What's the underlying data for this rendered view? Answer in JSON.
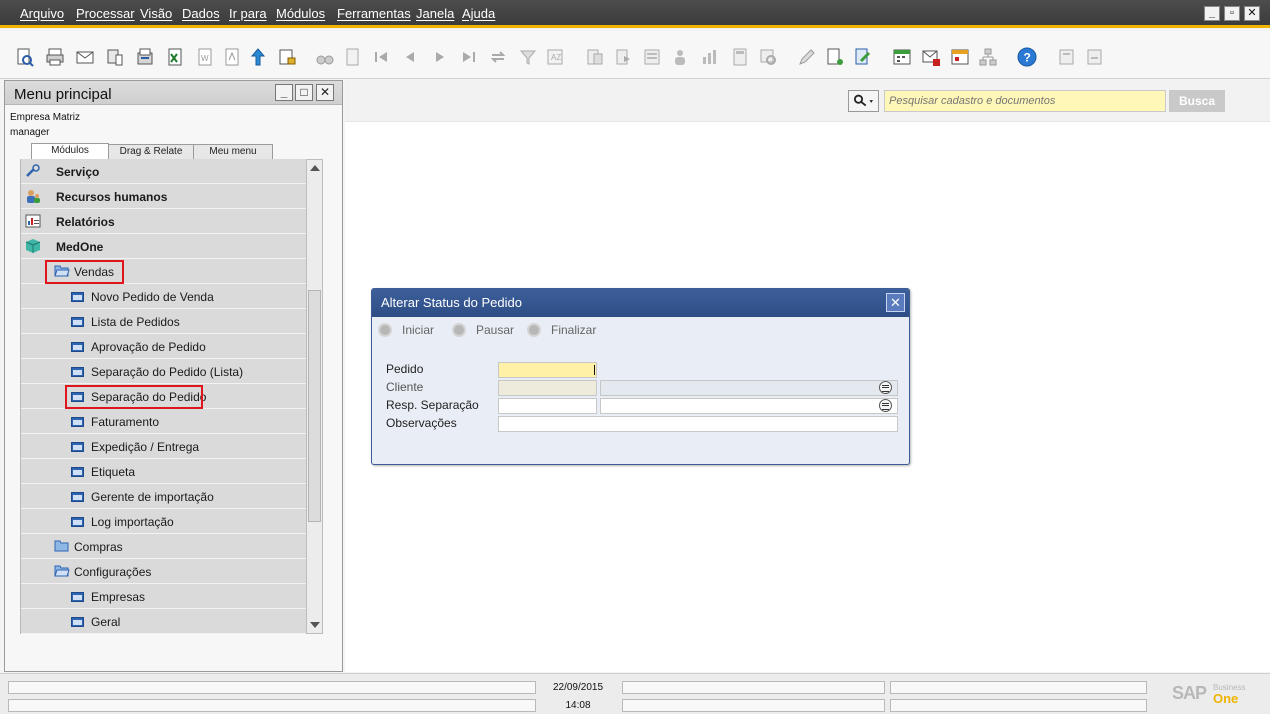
{
  "menubar": {
    "items": [
      "Arquivo",
      "Processar",
      "Visão",
      "Dados",
      "Ir para",
      "Módulos",
      "Ferramentas",
      "Janela",
      "Ajuda"
    ]
  },
  "left_panel": {
    "title": "Menu principal",
    "company": "Empresa Matriz",
    "user": "manager",
    "tabs": [
      "Módulos",
      "Drag & Relate",
      "Meu menu"
    ],
    "active_tab": "Módulos",
    "tree": [
      {
        "label": "Serviço",
        "level": 0,
        "icon": "wrench-icon"
      },
      {
        "label": "Recursos humanos",
        "level": 0,
        "icon": "people-icon"
      },
      {
        "label": "Relatórios",
        "level": 0,
        "icon": "report-icon"
      },
      {
        "label": "MedOne",
        "level": 0,
        "icon": "cube-icon"
      },
      {
        "label": "Vendas",
        "level": 1,
        "icon": "folder-open-icon",
        "highlighted": true
      },
      {
        "label": "Novo Pedido de Venda",
        "level": 2,
        "icon": "form-icon"
      },
      {
        "label": "Lista de Pedidos",
        "level": 2,
        "icon": "form-icon"
      },
      {
        "label": "Aprovação de Pedido",
        "level": 2,
        "icon": "form-icon"
      },
      {
        "label": "Separação do Pedido (Lista)",
        "level": 2,
        "icon": "form-icon"
      },
      {
        "label": "Separação do Pedido",
        "level": 2,
        "icon": "form-icon",
        "highlighted": true
      },
      {
        "label": "Faturamento",
        "level": 2,
        "icon": "form-icon"
      },
      {
        "label": "Expedição / Entrega",
        "level": 2,
        "icon": "form-icon"
      },
      {
        "label": "Etiqueta",
        "level": 2,
        "icon": "form-icon"
      },
      {
        "label": "Gerente de importação",
        "level": 2,
        "icon": "form-icon"
      },
      {
        "label": "Log importação",
        "level": 2,
        "icon": "form-icon"
      },
      {
        "label": "Compras",
        "level": 1,
        "icon": "folder-icon"
      },
      {
        "label": "Configurações",
        "level": 1,
        "icon": "folder-open-icon"
      },
      {
        "label": "Empresas",
        "level": 2,
        "icon": "form-icon"
      },
      {
        "label": "Geral",
        "level": 2,
        "icon": "form-icon"
      }
    ]
  },
  "search": {
    "placeholder": "Pesquisar cadastro e documentos",
    "button_label": "Busca"
  },
  "dialog": {
    "title": "Alterar Status do Pedido",
    "actions": [
      "Iniciar",
      "Pausar",
      "Finalizar"
    ],
    "fields": [
      {
        "label": "Pedido",
        "value": ""
      },
      {
        "label": "Cliente",
        "value": ""
      },
      {
        "label": "Resp. Separação",
        "value": ""
      },
      {
        "label": "Observações",
        "value": ""
      }
    ]
  },
  "statusbar": {
    "date": "22/09/2015",
    "time": "14:08",
    "brand_main": "SAP",
    "brand_sub1": "Business",
    "brand_sub2": "One"
  },
  "colors": {
    "accent": "#f0b400",
    "dialog_title": "#2e4d85",
    "highlight": "#e0161e"
  }
}
